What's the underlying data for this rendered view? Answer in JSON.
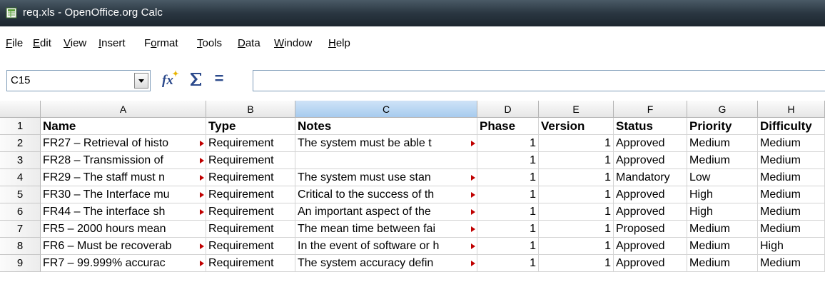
{
  "window": {
    "title": "req.xls - OpenOffice.org Calc"
  },
  "menu": [
    {
      "label": "File",
      "u": "F",
      "rest": "ile"
    },
    {
      "label": "Edit",
      "u": "E",
      "rest": "dit"
    },
    {
      "label": "View",
      "u": "V",
      "rest": "iew"
    },
    {
      "label": "Insert",
      "u": "I",
      "rest": "nsert"
    },
    {
      "label": "Format",
      "pre": "F",
      "u": "o",
      "rest": "rmat"
    },
    {
      "label": "Tools",
      "u": "T",
      "rest": "ools"
    },
    {
      "label": "Data",
      "u": "D",
      "rest": "ata"
    },
    {
      "label": "Window",
      "u": "W",
      "rest": "indow"
    },
    {
      "label": "Help",
      "u": "H",
      "rest": "elp"
    }
  ],
  "formula_bar": {
    "cell_ref": "C15",
    "content": "",
    "equals_symbol": "=",
    "icons": [
      "function-wizard-icon",
      "sum-icon",
      "equals-icon"
    ]
  },
  "columns": [
    "A",
    "B",
    "C",
    "D",
    "E",
    "F",
    "G",
    "H"
  ],
  "selected_column": "C",
  "rows": [
    {
      "num": "1",
      "cells": [
        "Name",
        "Type",
        "Notes",
        "Phase",
        "Version",
        "Status",
        "Priority",
        "Difficulty"
      ]
    },
    {
      "num": "2",
      "cells": [
        "FR27 – Retrieval of histo",
        "Requirement",
        "The system must be able t",
        "1",
        "1",
        "Approved",
        "Medium",
        "Medium"
      ]
    },
    {
      "num": "3",
      "cells": [
        "FR28 – Transmission of",
        "Requirement",
        "",
        "1",
        "1",
        "Approved",
        "Medium",
        "Medium"
      ]
    },
    {
      "num": "4",
      "cells": [
        "FR29 – The staff must n",
        "Requirement",
        "The system must use stan",
        "1",
        "1",
        "Mandatory",
        "Low",
        "Medium"
      ]
    },
    {
      "num": "5",
      "cells": [
        "FR30 – The Interface mu",
        "Requirement",
        "Critical to the success of th",
        "1",
        "1",
        "Approved",
        "High",
        "Medium"
      ]
    },
    {
      "num": "6",
      "cells": [
        "FR44 – The interface sh",
        "Requirement",
        "An important aspect of the",
        "1",
        "1",
        "Approved",
        "High",
        "Medium"
      ]
    },
    {
      "num": "7",
      "cells": [
        "FR5 – 2000 hours mean",
        "Requirement",
        "The mean time between fai",
        "1",
        "1",
        "Proposed",
        "Medium",
        "Medium"
      ]
    },
    {
      "num": "8",
      "cells": [
        "FR6 – Must be recoverab",
        "Requirement",
        "In the event of software or h",
        "1",
        "1",
        "Approved",
        "Medium",
        "High"
      ]
    },
    {
      "num": "9",
      "cells": [
        "FR7 – 99.999% accurac",
        "Requirement",
        "The system accuracy defin",
        "1",
        "1",
        "Approved",
        "Medium",
        "Medium"
      ]
    }
  ],
  "colors": {
    "title_bar": "#2a3641",
    "selected_column_header": "#a7cbee",
    "overflow_marker": "#c00000",
    "grid_line": "#d4d4d4"
  }
}
